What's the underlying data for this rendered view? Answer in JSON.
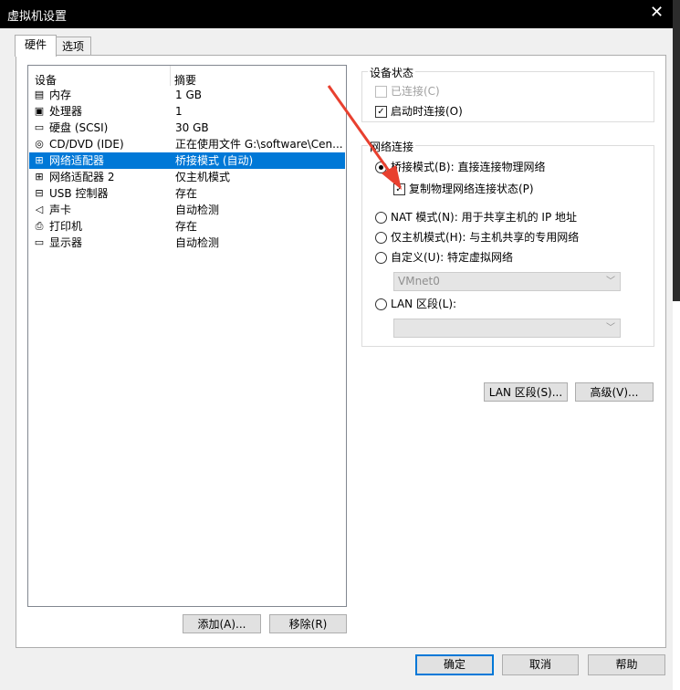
{
  "window": {
    "title": "虚拟机设置",
    "close_glyph": "✕"
  },
  "tabs": [
    {
      "label": "硬件",
      "active": true
    },
    {
      "label": "选项",
      "active": false
    }
  ],
  "device_list": {
    "headers": {
      "device": "设备",
      "summary": "摘要"
    },
    "rows": [
      {
        "icon": "memory-icon",
        "glyph": "▤",
        "name": "内存",
        "summary": "1 GB",
        "selected": false
      },
      {
        "icon": "processor-icon",
        "glyph": "▣",
        "name": "处理器",
        "summary": "1",
        "selected": false
      },
      {
        "icon": "harddisk-icon",
        "glyph": "▭",
        "name": "硬盘 (SCSI)",
        "summary": "30 GB",
        "selected": false
      },
      {
        "icon": "cdrom-icon",
        "glyph": "◎",
        "name": "CD/DVD (IDE)",
        "summary": "正在使用文件 G:\\software\\Cen...",
        "selected": false
      },
      {
        "icon": "network-adapter-icon",
        "glyph": "⊞",
        "name": "网络适配器",
        "summary": "桥接模式 (自动)",
        "selected": true
      },
      {
        "icon": "network-adapter-icon",
        "glyph": "⊞",
        "name": "网络适配器 2",
        "summary": "仅主机模式",
        "selected": false
      },
      {
        "icon": "usb-icon",
        "glyph": "⊟",
        "name": "USB 控制器",
        "summary": "存在",
        "selected": false
      },
      {
        "icon": "sound-icon",
        "glyph": "◁",
        "name": "声卡",
        "summary": "自动检测",
        "selected": false
      },
      {
        "icon": "printer-icon",
        "glyph": "⎙",
        "name": "打印机",
        "summary": "存在",
        "selected": false
      },
      {
        "icon": "display-icon",
        "glyph": "▭",
        "name": "显示器",
        "summary": "自动检测",
        "selected": false
      }
    ]
  },
  "list_buttons": {
    "add": "添加(A)...",
    "remove": "移除(R)"
  },
  "device_status": {
    "legend": "设备状态",
    "connected": {
      "label": "已连接(C)",
      "checked": false,
      "enabled": false
    },
    "connect_on_start": {
      "label": "启动时连接(O)",
      "checked": true
    }
  },
  "network_connection": {
    "legend": "网络连接",
    "bridged": {
      "label": "桥接模式(B): 直接连接物理网络",
      "selected": true
    },
    "replicate": {
      "label": "复制物理网络连接状态(P)",
      "checked": true
    },
    "nat": {
      "label": "NAT 模式(N): 用于共享主机的 IP 地址",
      "selected": false
    },
    "host_only": {
      "label": "仅主机模式(H): 与主机共享的专用网络",
      "selected": false
    },
    "custom": {
      "label": "自定义(U): 特定虚拟网络",
      "selected": false
    },
    "custom_network": "VMnet0",
    "lan_segment": {
      "label": "LAN 区段(L):",
      "selected": false
    },
    "lan_segment_value": ""
  },
  "network_buttons": {
    "lan_segments": "LAN 区段(S)...",
    "advanced": "高级(V)..."
  },
  "dialog_buttons": {
    "ok": "确定",
    "cancel": "取消",
    "help": "帮助"
  },
  "colors": {
    "selection": "#0078d7",
    "annotation_arrow": "#e8402f"
  }
}
